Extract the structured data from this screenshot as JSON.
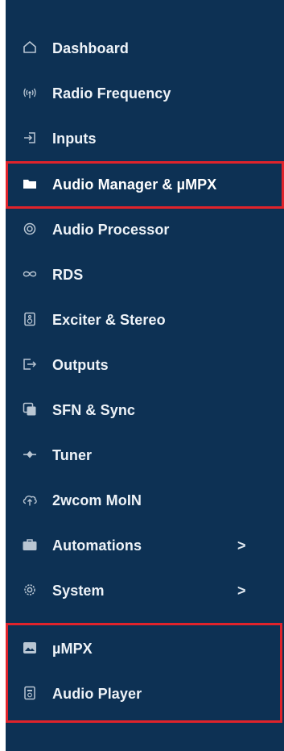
{
  "sidebar": {
    "items": [
      {
        "label": "Dashboard",
        "icon": "home-icon"
      },
      {
        "label": "Radio Frequency",
        "icon": "radio-waves-icon"
      },
      {
        "label": "Inputs",
        "icon": "input-arrow-icon"
      },
      {
        "label": "Audio Manager & µMPX",
        "icon": "folder-icon",
        "active": true
      },
      {
        "label": "Audio Processor",
        "icon": "processor-icon"
      },
      {
        "label": "RDS",
        "icon": "infinity-icon"
      },
      {
        "label": "Exciter & Stereo",
        "icon": "speaker-icon"
      },
      {
        "label": "Outputs",
        "icon": "output-arrow-icon"
      },
      {
        "label": "SFN & Sync",
        "icon": "layers-icon"
      },
      {
        "label": "Tuner",
        "icon": "tuner-icon"
      },
      {
        "label": "2wcom MoIN",
        "icon": "cloud-upload-icon"
      },
      {
        "label": "Automations",
        "icon": "briefcase-icon",
        "chevron": ">"
      },
      {
        "label": "System",
        "icon": "gear-icon",
        "chevron": ">"
      },
      {
        "label": "µMPX",
        "icon": "image-icon"
      },
      {
        "label": "Audio Player",
        "icon": "player-icon"
      }
    ]
  },
  "colors": {
    "sidebar_background": "#0d3154",
    "text": "#eef3f8",
    "icon": "#b9c6d3",
    "highlight": "#e0232b"
  }
}
